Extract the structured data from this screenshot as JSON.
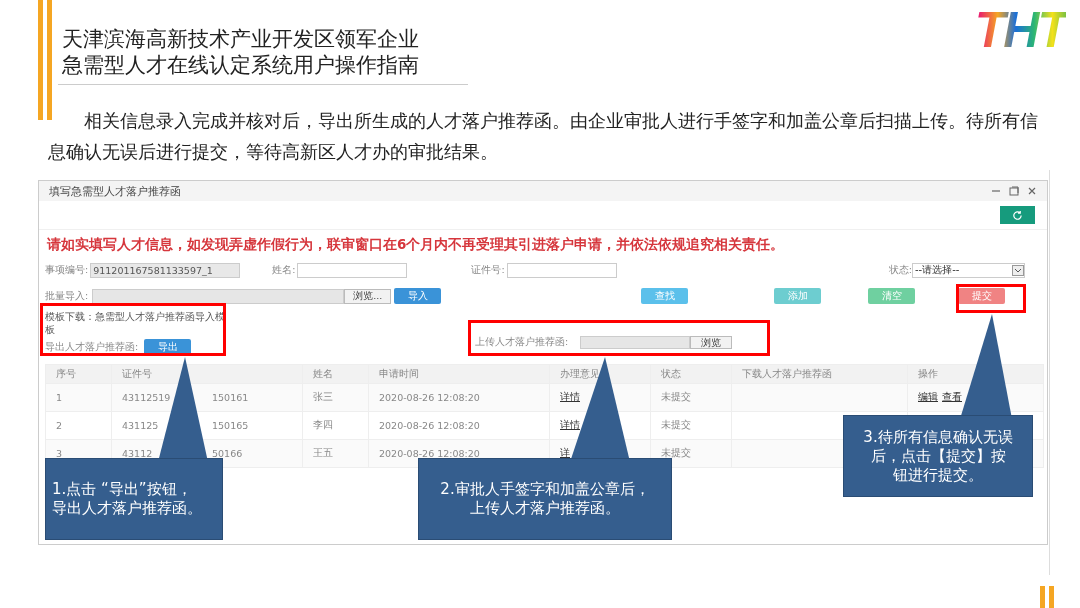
{
  "slide": {
    "title_lines": [
      "天津滨海高新技术产业开发区领军企业",
      "急需型人才在线认定系统用户操作指南"
    ],
    "logo_text": "THT",
    "paragraph": "相关信息录入完成并核对后，导出所生成的人才落户推荐函。由企业审批人进行手签字和加盖公章后扫描上传。待所有信息确认无误后进行提交，等待高新区人才办的审批结果。"
  },
  "window": {
    "title": "填写急需型人才落户推荐函",
    "warning": "请如实填写人才信息，如发现弄虚作假行为，联审窗口在6个月内不再受理其引进落户申请，并依法依规追究相关责任。",
    "fields": [
      {
        "label": "事项编号:",
        "value": "911201167581133597_1",
        "disabled": true
      },
      {
        "label": "姓名:",
        "disabled": false
      },
      {
        "label": "证件号:",
        "disabled": false
      }
    ],
    "status": {
      "label": "状态:",
      "value": "--请选择--"
    },
    "import": {
      "label": "批量导入:",
      "browse": "浏览...",
      "button": "导入"
    },
    "actions": [
      {
        "label": "查找",
        "color": "#5bc0eb"
      },
      {
        "label": "添加",
        "color": "#6dcdd0"
      },
      {
        "label": "清空",
        "color": "#6fd0a0"
      },
      {
        "label": "提交",
        "color": "#f08383"
      }
    ],
    "template_lines": [
      "模板下载：急需型人才落户推荐函导入模",
      "板"
    ],
    "export": {
      "label": "导出人才落户推荐函:",
      "button": "导出"
    },
    "upload": {
      "label": "上传人才落户推荐函:",
      "browse": "浏览"
    },
    "table": {
      "columns": [
        "序号",
        "证件号",
        "姓名",
        "申请时间",
        "办理意见",
        "状态",
        "下载人才落户推荐函",
        "操作"
      ],
      "rows": [
        {
          "cells": [
            "1",
            [
              "43112519",
              "150161"
            ],
            "张三",
            "2020-08-26 12:08:20",
            "详情",
            "未提交",
            "",
            [
              "编辑",
              "查看"
            ]
          ]
        },
        {
          "cells": [
            "2",
            [
              "431125",
              "150165"
            ],
            "李四",
            "2020-08-26 12:08:20",
            "详情",
            "未提交",
            "",
            []
          ]
        },
        {
          "cells": [
            "3",
            [
              "43112",
              "50166"
            ],
            "王五",
            "2020-08-26 12:08:20",
            "详",
            "未提交",
            "",
            []
          ]
        }
      ]
    }
  },
  "callouts": [
    {
      "lines": [
        "1.点击 “导出”按钮，",
        "导出人才落户推荐函。"
      ]
    },
    {
      "lines": [
        "2.审批人手签字和加盖公章后，",
        "上传人才落户推荐函。"
      ]
    },
    {
      "lines": [
        "3.待所有信息确认无误",
        "后，点击【提交】按",
        "钮进行提交。"
      ]
    }
  ]
}
